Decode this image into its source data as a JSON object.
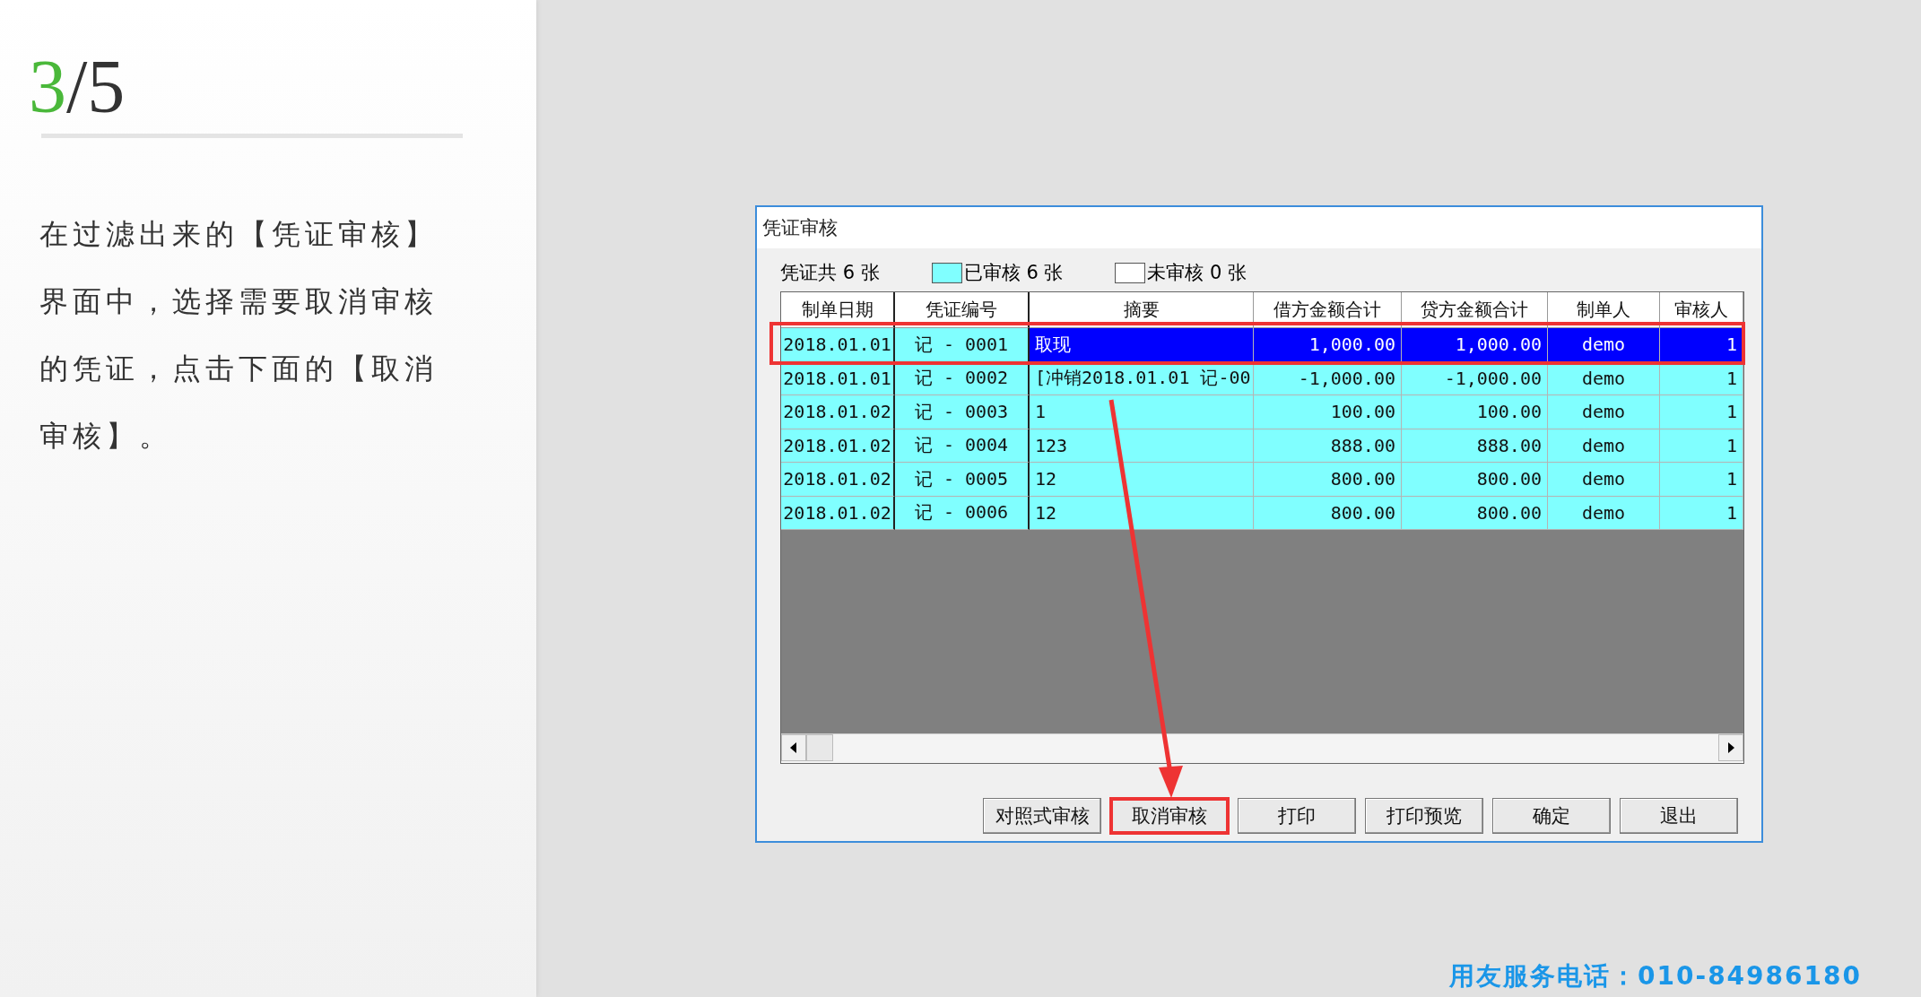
{
  "step": {
    "current": "3",
    "rest": "/5"
  },
  "instruction": "在过滤出来的【凭证审核】界面中，选择需要取消审核的凭证，点击下面的【取消审核】。",
  "window": {
    "title": "凭证审核"
  },
  "legend": {
    "total": "凭证共 6 张",
    "items": [
      {
        "label": "已审核 6 张",
        "color": "#80ffff"
      },
      {
        "label": "未审核 0 张",
        "color": "#ffffff"
      }
    ]
  },
  "table": {
    "columns": [
      {
        "label": "制单日期"
      },
      {
        "label": "凭证编号"
      },
      {
        "label": "摘要"
      },
      {
        "label": "借方金额合计"
      },
      {
        "label": "贷方金额合计"
      },
      {
        "label": "制单人"
      },
      {
        "label": "审核人"
      }
    ],
    "rows": [
      {
        "selected": true,
        "highlighted": true,
        "cells": [
          "2018.01.01",
          "记 - 0001",
          "取现",
          "1,000.00",
          "1,000.00",
          "demo",
          "1"
        ]
      },
      {
        "selected": false,
        "highlighted": false,
        "cells": [
          "2018.01.01",
          "记 - 0002",
          "[冲销2018.01.01 记-00",
          "-1,000.00",
          "-1,000.00",
          "demo",
          "1"
        ]
      },
      {
        "selected": false,
        "highlighted": false,
        "cells": [
          "2018.01.02",
          "记 - 0003",
          "1",
          "100.00",
          "100.00",
          "demo",
          "1"
        ]
      },
      {
        "selected": false,
        "highlighted": false,
        "cells": [
          "2018.01.02",
          "记 - 0004",
          "123",
          "888.00",
          "888.00",
          "demo",
          "1"
        ]
      },
      {
        "selected": false,
        "highlighted": false,
        "cells": [
          "2018.01.02",
          "记 - 0005",
          "12",
          "800.00",
          "800.00",
          "demo",
          "1"
        ]
      },
      {
        "selected": false,
        "highlighted": false,
        "cells": [
          "2018.01.02",
          "记 - 0006",
          "12",
          "800.00",
          "800.00",
          "demo",
          "1"
        ]
      }
    ]
  },
  "buttons": [
    {
      "label": "对照式审核",
      "highlighted": false
    },
    {
      "label": "取消审核",
      "highlighted": true
    },
    {
      "label": "打印",
      "highlighted": false
    },
    {
      "label": "打印预览",
      "highlighted": false
    },
    {
      "label": "确定",
      "highlighted": false
    },
    {
      "label": "退出",
      "highlighted": false
    }
  ],
  "footer": "用友服务电话：010-84986180"
}
